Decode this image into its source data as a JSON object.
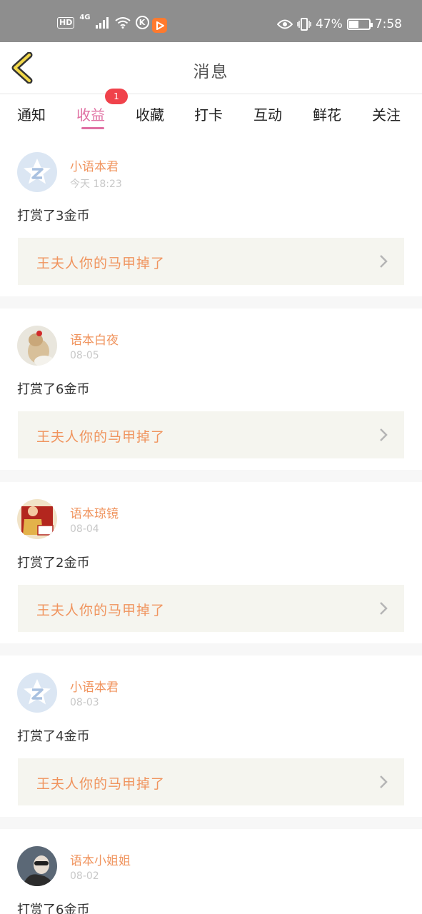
{
  "status_bar": {
    "hd": "HD",
    "network": "4G",
    "k_icon": "K",
    "battery": "47%",
    "battery_level": 0.47,
    "time": "7:58"
  },
  "header": {
    "title": "消息"
  },
  "tabs": [
    {
      "label": "通知"
    },
    {
      "label": "收益",
      "badge": "1"
    },
    {
      "label": "收藏"
    },
    {
      "label": "打卡"
    },
    {
      "label": "互动"
    },
    {
      "label": "鲜花"
    },
    {
      "label": "关注"
    }
  ],
  "messages": [
    {
      "username": "小语本君",
      "date": "今天 18:23",
      "reward": "打赏了3金币",
      "link": "王夫人你的马甲掉了",
      "avatar": "default-avatar-icon"
    },
    {
      "username": "语本白夜",
      "date": "08-05",
      "reward": "打赏了6金币",
      "link": "王夫人你的马甲掉了",
      "avatar": "photo-avatar"
    },
    {
      "username": "语本琼镜",
      "date": "08-04",
      "reward": "打赏了2金币",
      "link": "王夫人你的马甲掉了",
      "avatar": "photo-avatar"
    },
    {
      "username": "小语本君",
      "date": "08-03",
      "reward": "打赏了4金币",
      "link": "王夫人你的马甲掉了",
      "avatar": "default-avatar-icon"
    },
    {
      "username": "语本小姐姐",
      "date": "08-02",
      "reward": "打赏了6金币",
      "link": "",
      "avatar": "photo-avatar"
    }
  ],
  "colors": {
    "accent": "#e06fa2",
    "name": "#f0945e",
    "badge": "#f0424b"
  }
}
